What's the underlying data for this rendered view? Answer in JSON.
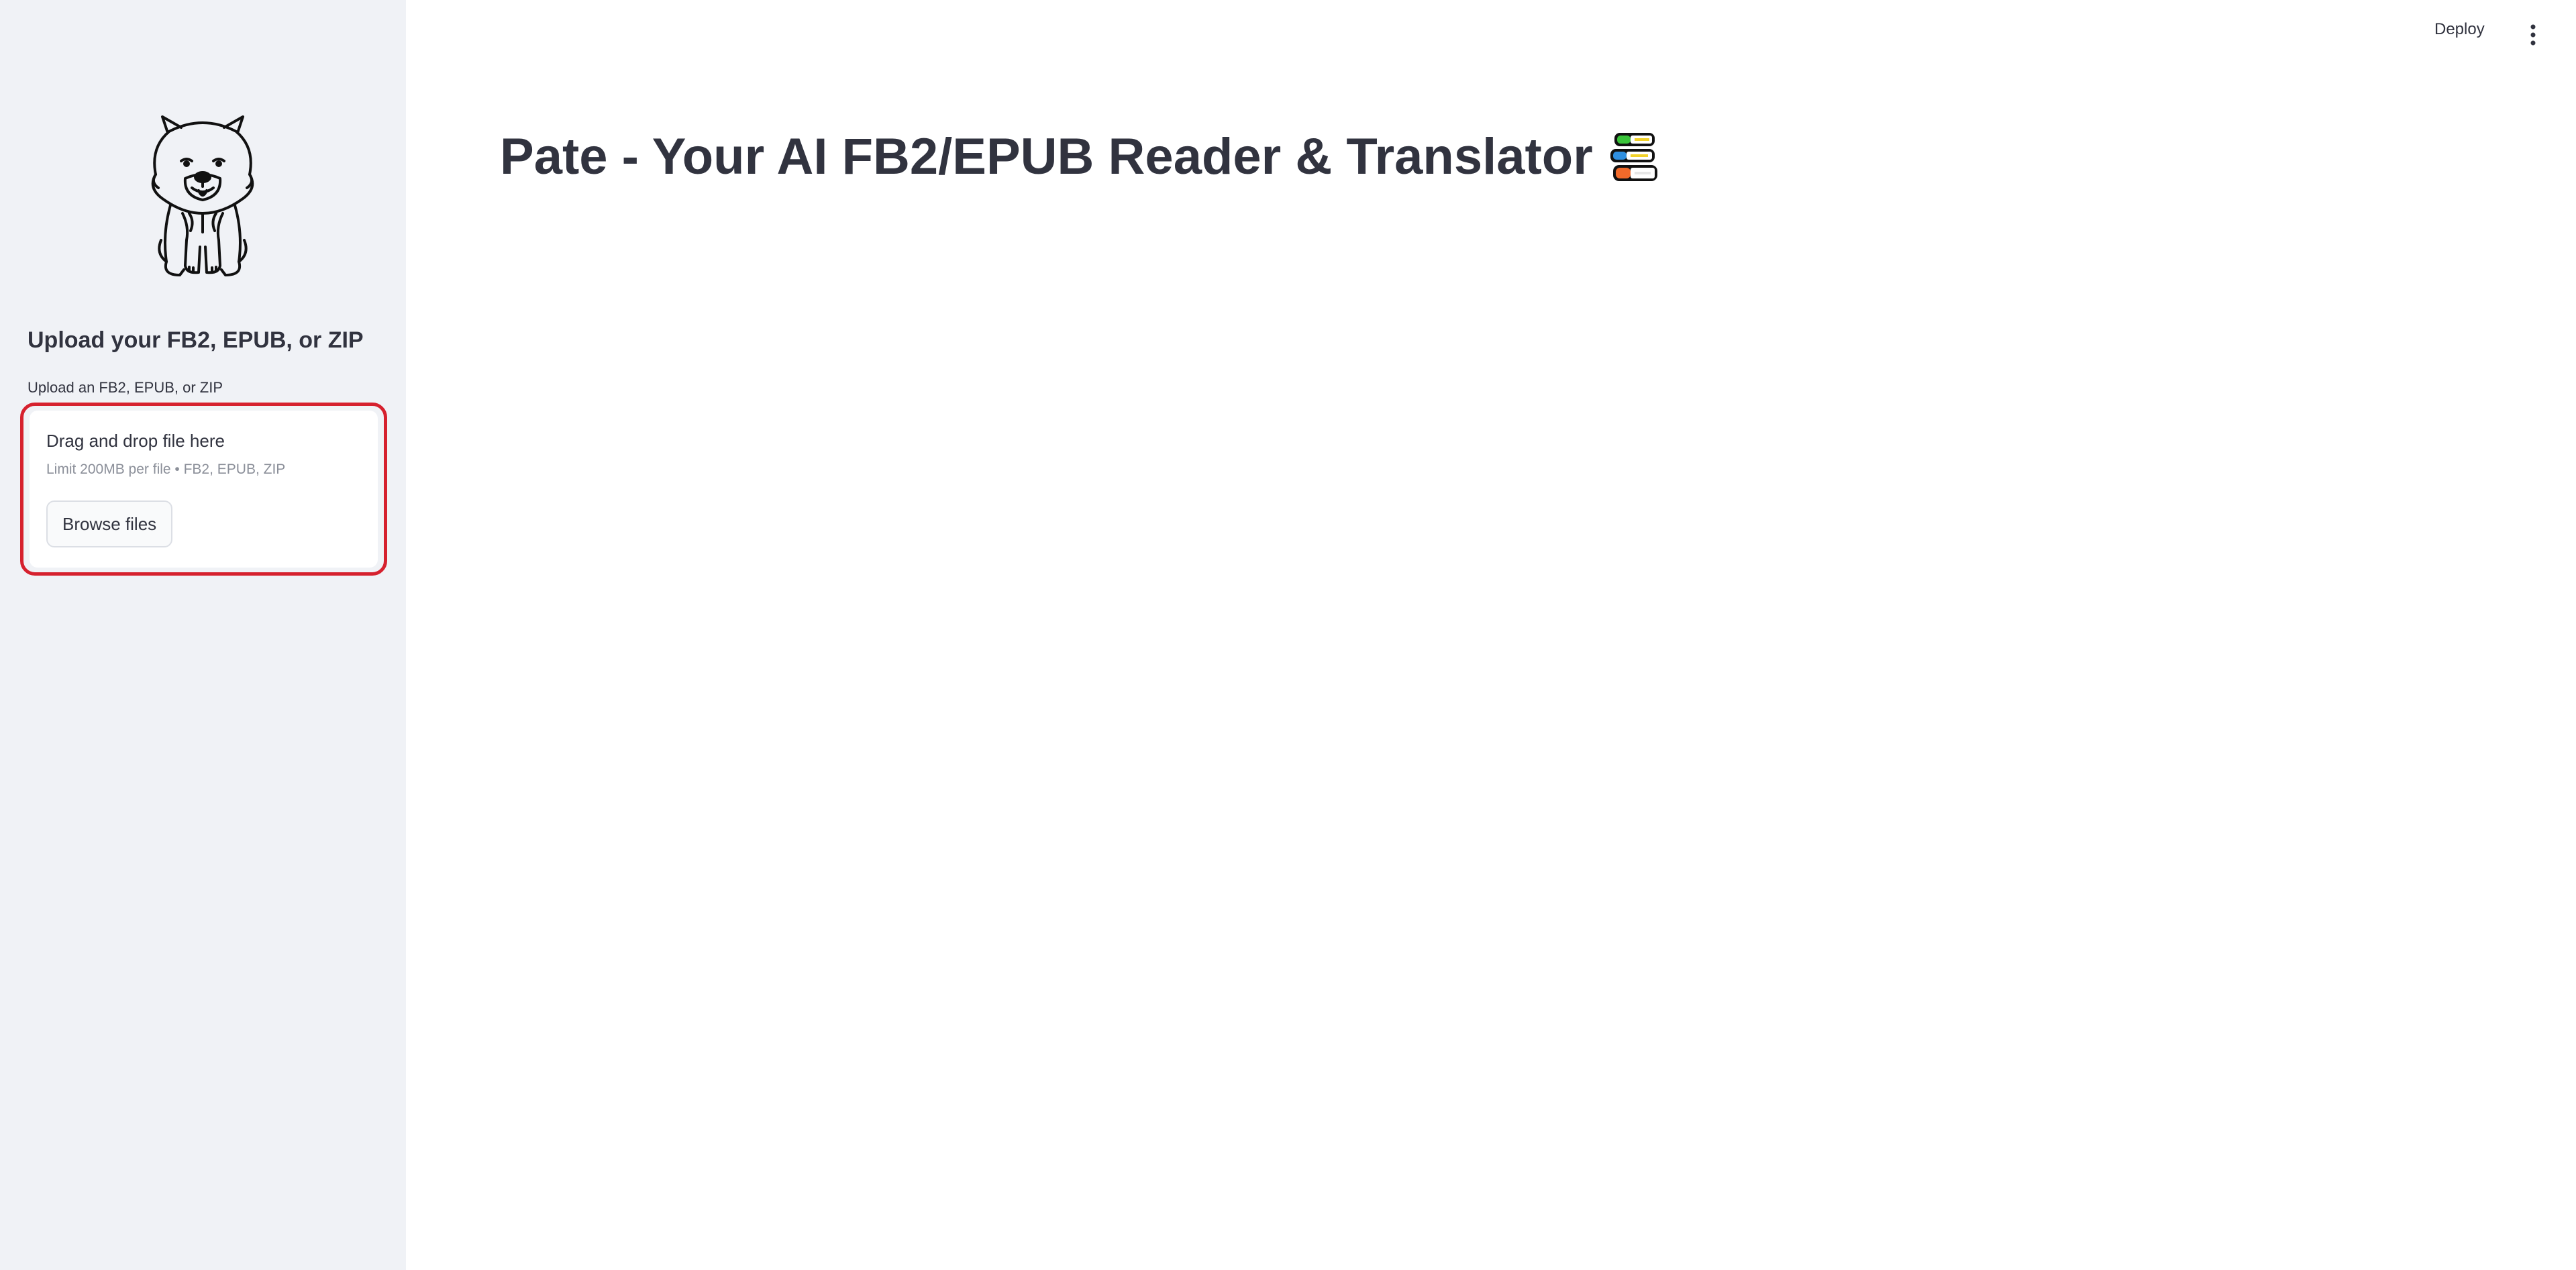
{
  "sidebar": {
    "logo": "chow-chow-dog-logo",
    "heading": "Upload your FB2, EPUB, or ZIP",
    "uploader": {
      "label": "Upload an FB2, EPUB, or ZIP",
      "drop_text": "Drag and drop file here",
      "limit_text": "Limit 200MB per file • FB2, EPUB, ZIP",
      "browse_label": "Browse files"
    },
    "highlight_color": "#d6212e"
  },
  "header": {
    "deploy_label": "Deploy",
    "menu_icon": "vertical-dots-icon"
  },
  "main": {
    "title": "Pate - Your AI FB2/EPUB Reader & Translator",
    "title_icon": "books-icon"
  },
  "colors": {
    "sidebar_bg": "#f0f2f6",
    "text": "#31333f",
    "muted": "#8b8f99"
  }
}
